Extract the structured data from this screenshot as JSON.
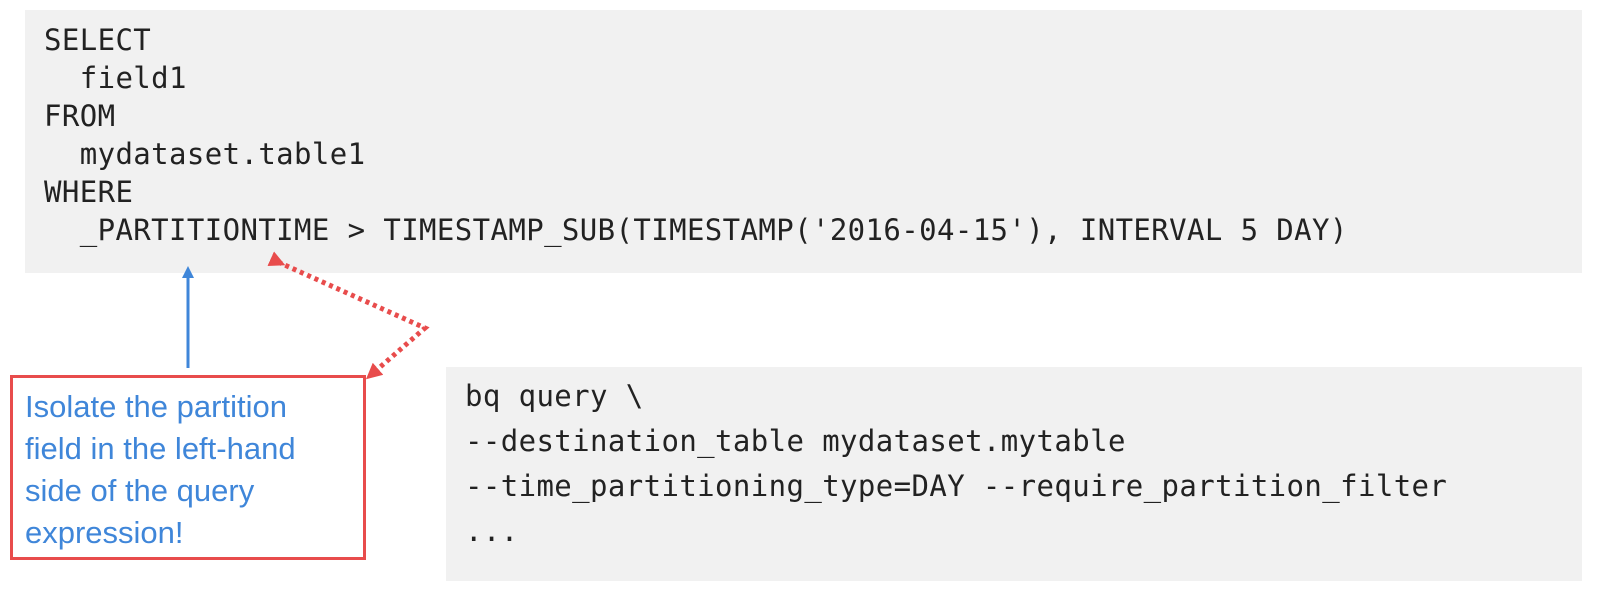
{
  "sql_query": {
    "lines": [
      "SELECT",
      "  field1",
      "FROM",
      "  mydataset.table1",
      "WHERE",
      "  _PARTITIONTIME > TIMESTAMP_SUB(TIMESTAMP('2016-04-15'), INTERVAL 5 DAY)"
    ]
  },
  "bq_command": {
    "lines": [
      "bq query \\",
      "--destination_table mydataset.mytable",
      "--time_partitioning_type=DAY --require_partition_filter",
      "..."
    ]
  },
  "callout": {
    "text": "Isolate the partition field in the left-hand side of the query expression!"
  },
  "colors": {
    "code_background": "#f1f1f1",
    "callout_border": "#e84c4c",
    "callout_text": "#3f86d9",
    "solid_arrow": "#3f86d9",
    "dotted_arrow": "#e84c4c"
  }
}
